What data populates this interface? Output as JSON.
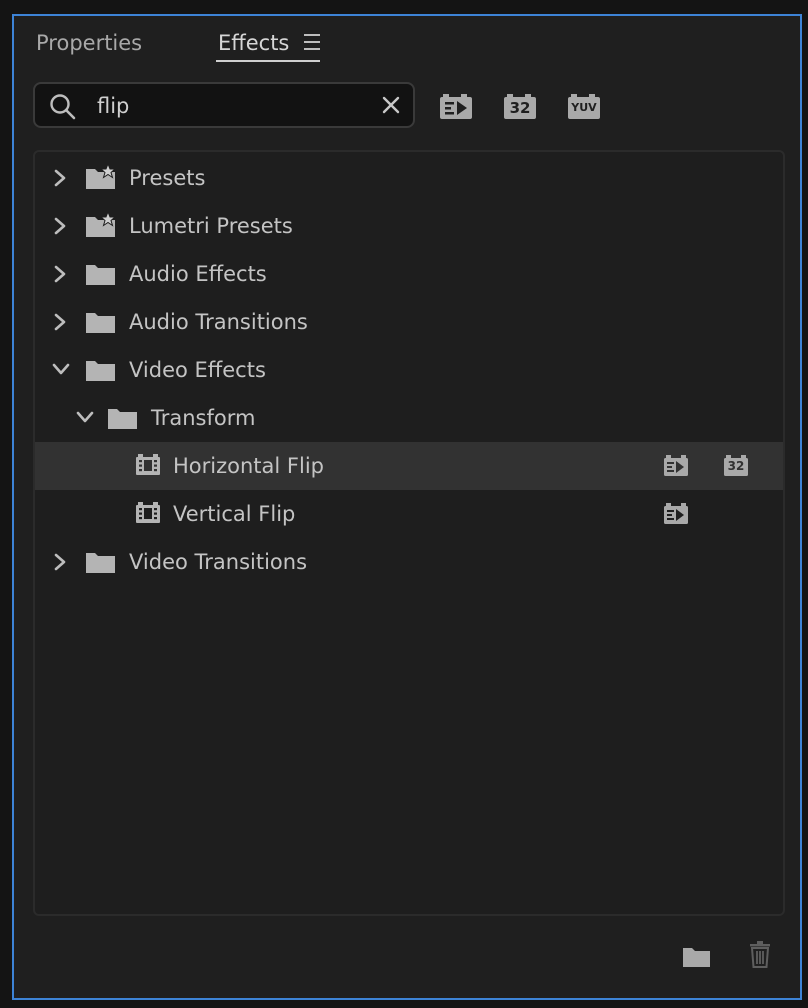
{
  "tabs": {
    "properties": "Properties",
    "effects": "Effects"
  },
  "search": {
    "value": "flip",
    "placeholder": ""
  },
  "filters": {
    "yuv_label": "YUV",
    "bit_label": "32"
  },
  "tree": {
    "items": [
      {
        "label": "Presets",
        "state": "collapsed",
        "icon": "preset-folder-icon"
      },
      {
        "label": "Lumetri Presets",
        "state": "collapsed",
        "icon": "preset-folder-icon"
      },
      {
        "label": "Audio Effects",
        "state": "collapsed",
        "icon": "folder-icon"
      },
      {
        "label": "Audio Transitions",
        "state": "collapsed",
        "icon": "folder-icon"
      },
      {
        "label": "Video Effects",
        "state": "expanded",
        "icon": "folder-icon"
      },
      {
        "label": "Transform",
        "state": "expanded",
        "icon": "folder-icon"
      },
      {
        "label": "Horizontal Flip",
        "icon": "effect-icon",
        "badges": [
          "accelerated-icon",
          "32-bit-icon"
        ],
        "selected": true
      },
      {
        "label": "Vertical Flip",
        "icon": "effect-icon",
        "badges": [
          "accelerated-icon"
        ]
      },
      {
        "label": "Video Transitions",
        "state": "collapsed",
        "icon": "folder-icon"
      }
    ]
  },
  "colors": {
    "panel_border": "#3d83d6",
    "panel_bg": "#1f1f1f",
    "selected_row": "#323232",
    "text": "#c4c4c4"
  }
}
